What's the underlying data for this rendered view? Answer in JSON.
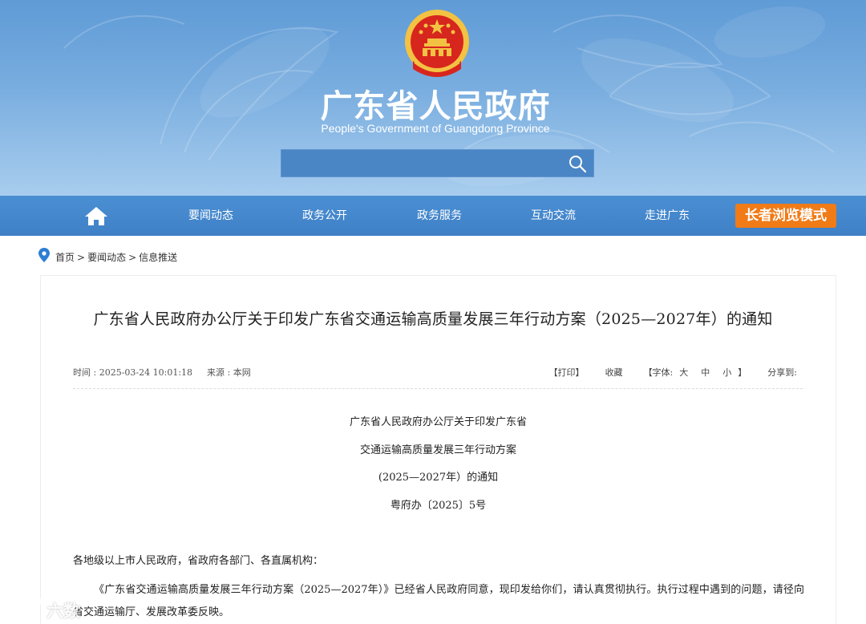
{
  "header": {
    "title": "广东省人民政府",
    "subtitle": "People's Government of Guangdong Province",
    "search": {
      "placeholder": "",
      "icon": "search-icon"
    }
  },
  "nav": {
    "items": [
      {
        "label": "要闻动态"
      },
      {
        "label": "政务公开"
      },
      {
        "label": "政务服务"
      },
      {
        "label": "互动交流"
      },
      {
        "label": "走进广东"
      }
    ],
    "elder_mode": "长者浏览模式",
    "home_icon": "home-icon"
  },
  "breadcrumb": {
    "items": [
      "首页",
      "要闻动态",
      "信息推送"
    ],
    "separator": ">",
    "icon": "location-pin-icon"
  },
  "article": {
    "title": "广东省人民政府办公厅关于印发广东省交通运输高质量发展三年行动方案（2025—2027年）的通知",
    "time": "时间 : 2025-03-24 10:01:18",
    "source": "来源 : 本网",
    "tools": {
      "print": "【打印】",
      "favorite": "收藏",
      "font_prefix": "【字体:",
      "font_large": "大",
      "font_medium": "中",
      "font_small": "小",
      "font_suffix": "】",
      "share": "分享到:"
    },
    "doc_header": [
      "广东省人民政府办公厅关于印发广东省",
      "交通运输高质量发展三年行动方案",
      "(2025—2027年）的通知",
      "粤府办〔2025〕5号"
    ],
    "salutation": "各地级以上市人民政府，省政府各部门、各直属机构：",
    "paragraph": "《广东省交通运输高质量发展三年行动方案（2025—2027年）》已经省人民政府同意，现印发给你们，请认真贯彻执行。执行过程中遇到的问题，请径向省交通运输厅、发展改革委反映。"
  },
  "watermark": {
    "text": "六数"
  },
  "colors": {
    "nav_bg": "#4286cb",
    "elder_button": "#f07b17",
    "banner_top": "#5f9bd6",
    "emblem_red": "#d7261e",
    "emblem_gold": "#f3c242"
  }
}
